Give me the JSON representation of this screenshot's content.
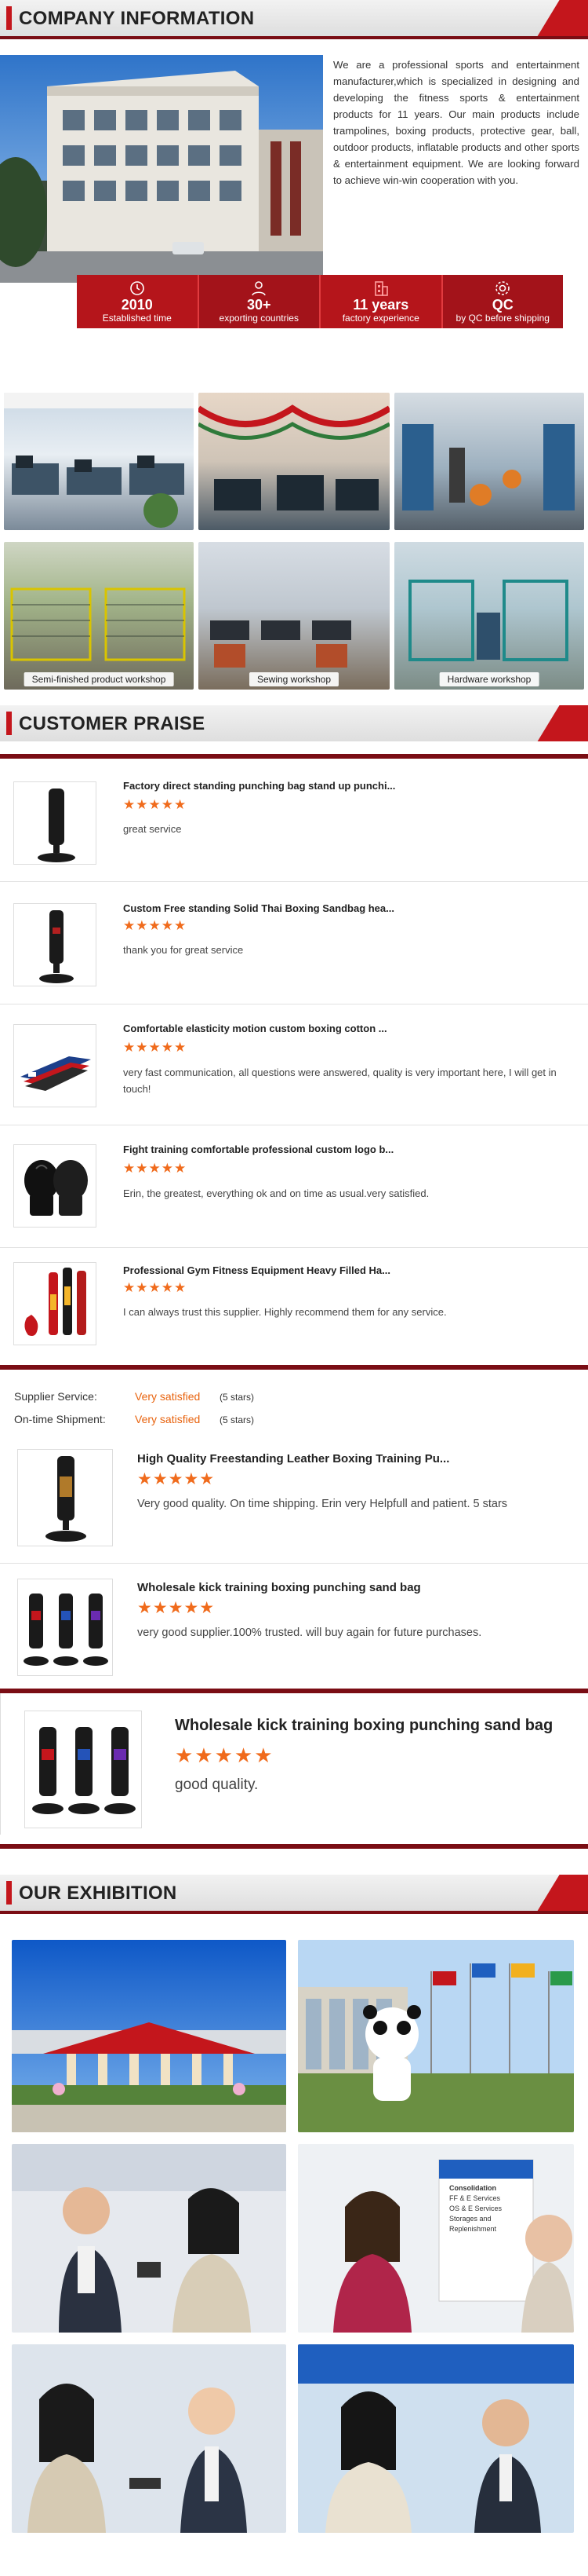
{
  "company": {
    "section_title": "COMPANY INFORMATION",
    "intro": "We are a professional sports and entertainment manufacturer,which is specialized in designing and developing the fitness sports & entertainment products for 11 years. Our main products include trampolines, boxing products, protective gear, ball, outdoor products, inflatable products and other sports & entertainment equipment. We are looking forward to achieve win-win cooperation with you.",
    "stats": [
      {
        "value": "2010",
        "label": "Established time",
        "icon": "clock-icon"
      },
      {
        "value": "30+",
        "label": "exporting countries",
        "icon": "person-icon"
      },
      {
        "value": "11 years",
        "label": "factory experience",
        "icon": "building-icon"
      },
      {
        "value": "QC",
        "label": "by QC before shipping",
        "icon": "gear-icon"
      }
    ],
    "workshops": [
      "Semi-finished product workshop",
      "Sewing workshop",
      "Hardware workshop"
    ]
  },
  "praise": {
    "section_title": "CUSTOMER PRAISE",
    "stars": "★★★★★",
    "reviews": [
      {
        "title": "Factory direct standing punching bag stand up punchi...",
        "text": "great service"
      },
      {
        "title": "Custom Free standing Solid Thai Boxing Sandbag hea...",
        "text": "thank you for great service"
      },
      {
        "title": "Comfortable elasticity motion custom boxing cotton ...",
        "text": "very fast communication, all questions were answered, quality is very important here, I will get in touch!"
      },
      {
        "title": "Fight training comfortable professional custom logo b...",
        "text": "Erin, the greatest, everything ok and on time as usual.very satisfied."
      },
      {
        "title": "Professional Gym Fitness Equipment Heavy Filled Ha...",
        "text": "I can always trust this supplier. Highly recommend them for any service."
      }
    ],
    "ratings": [
      {
        "label": "Supplier Service:",
        "value": "Very satisfied",
        "stars": "(5 stars)"
      },
      {
        "label": "On-time Shipment:",
        "value": "Very satisfied",
        "stars": "(5 stars)"
      }
    ],
    "reviews2": [
      {
        "title": "High Quality Freestanding Leather Boxing Training Pu...",
        "text": "Very good quality. On time shipping. Erin very Helpfull and patient. 5 stars"
      },
      {
        "title": "Wholesale kick training boxing punching sand bag",
        "text": "very good supplier.100% trusted. will buy again for future purchases."
      }
    ],
    "featured": {
      "title": "Wholesale kick training boxing punching sand bag",
      "text": "good quality."
    }
  },
  "exhibition": {
    "section_title": "OUR EXHIBITION",
    "board_lines": [
      "Consolidation",
      "FF & E Services",
      "OS & E Services",
      "Storages and Replenishment"
    ]
  },
  "colors": {
    "accent": "#c4161c",
    "dark_red": "#7a0d14",
    "star": "#f06b1c",
    "satisfied": "#e8630e"
  }
}
